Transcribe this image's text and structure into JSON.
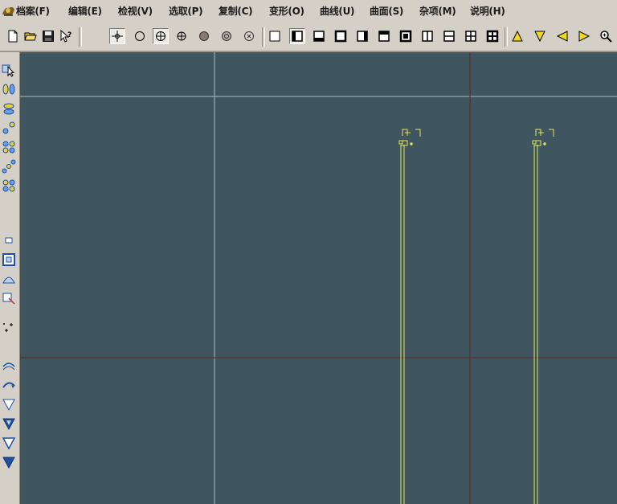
{
  "menu": {
    "items": [
      {
        "label": "档案(F)"
      },
      {
        "label": "编辑(E)"
      },
      {
        "label": "检视(V)"
      },
      {
        "label": "选取(P)"
      },
      {
        "label": "复制(C)"
      },
      {
        "label": "变形(O)"
      },
      {
        "label": "曲线(U)"
      },
      {
        "label": "曲面(S)"
      },
      {
        "label": "杂项(M)"
      },
      {
        "label": "说明(H)"
      }
    ]
  },
  "toolbar": {
    "icons": [
      "new-file-icon",
      "open-folder-icon",
      "save-icon",
      "help-pointer-icon",
      "snap-point-icon",
      "circle-snap-icon",
      "center-snap-icon",
      "grid-snap-icon",
      "filled-dot-icon",
      "sphere-icon",
      "rotate-icon",
      "view-single-icon",
      "view-left-icon",
      "view-bottom-icon",
      "view-square-icon",
      "view-right-icon",
      "view-top-icon",
      "view-back-icon",
      "split-vertical-icon",
      "split-horizontal-icon",
      "quad-view-icon",
      "quad-view-bold-icon",
      "arrow-up-icon",
      "arrow-down-icon",
      "arrow-left-icon",
      "arrow-right-icon",
      "zoom-icon"
    ]
  },
  "colors": {
    "viewport_bg": "#3f5660",
    "grid_light": "#a9b8bd",
    "axis_dark": "#5a2e22",
    "curve": "#e6e65a"
  }
}
